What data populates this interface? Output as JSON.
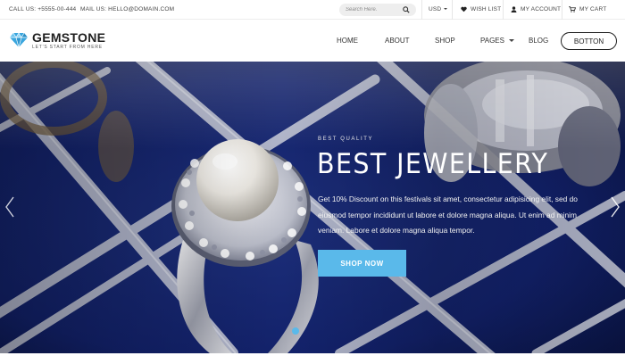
{
  "topbar": {
    "call_label": "CALL US: +5555-00-444",
    "mail_label": "MAIL US: HELLO@DOMAIN.COM",
    "search_placeholder": "Search Here.",
    "currency": "USD",
    "wishlist": "WISH LIST",
    "account": "MY ACCOUNT",
    "cart": "MY CART"
  },
  "header": {
    "logo_name": "GEMSTONE",
    "logo_tagline": "LET'S START FROM HERE",
    "nav": {
      "home": "HOME",
      "about": "ABOUT",
      "shop": "SHOP",
      "pages": "PAGES",
      "blog": "BLOG"
    },
    "cta_label": "BOTTON"
  },
  "hero": {
    "kicker": "BEST QUALITY",
    "headline": "BEST JEWELLERY",
    "description": "Get 10% Discount on this festivals sit amet, consectetur adipisicing elit, sed do eiusmod tempor incididunt ut labore et dolore magna aliqua. Ut enim ad minim veniam. Labore et dolore magna aliqua tempor.",
    "button_label": "SHOP NOW"
  },
  "colors": {
    "accent": "#5ab9ea",
    "hero_navy": "#0e1a52",
    "logo_gem": "#3aa6de"
  },
  "icons": [
    "search-icon",
    "caret-down-icon",
    "heart-icon",
    "user-icon",
    "cart-icon",
    "diamond-icon",
    "chevron-left-icon",
    "chevron-right-icon"
  ]
}
